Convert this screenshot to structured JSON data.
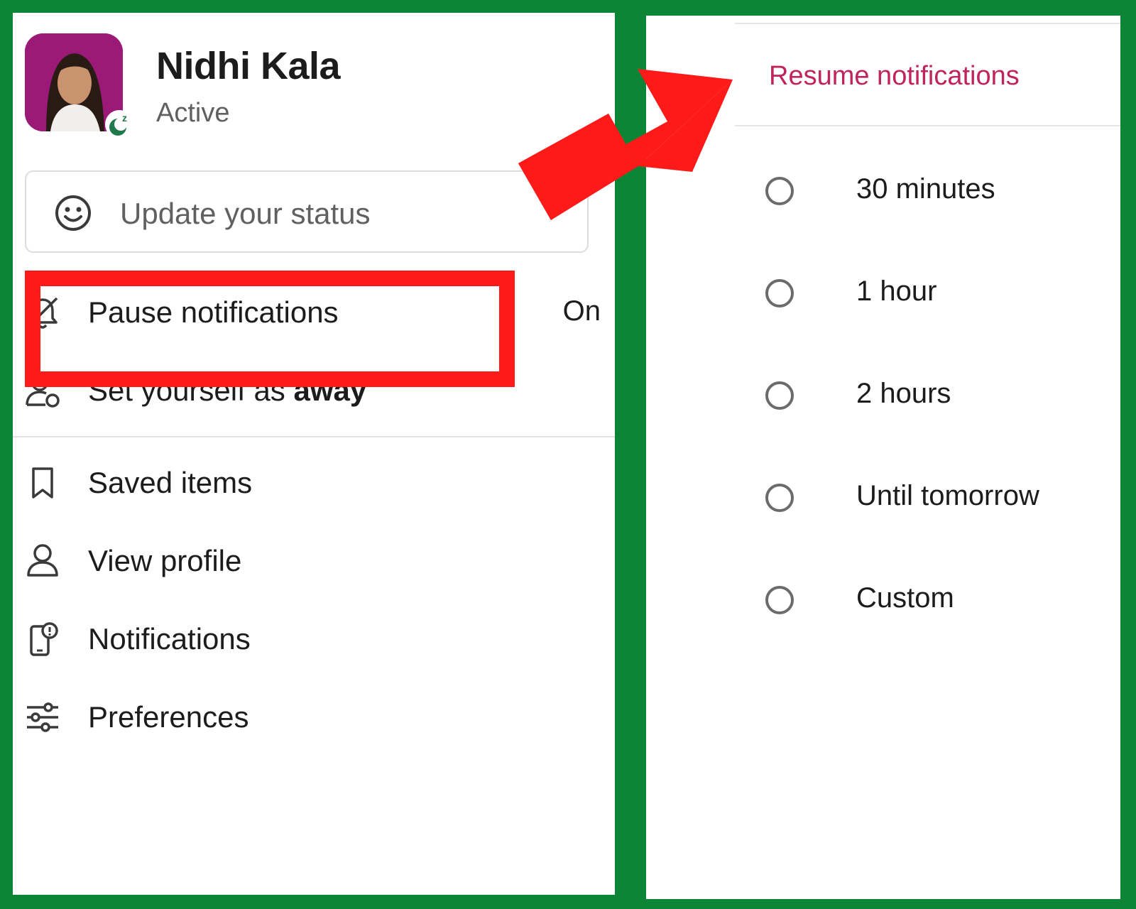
{
  "profile": {
    "name": "Nidhi Kala",
    "presence": "Active",
    "badge_icon": "snooze-icon"
  },
  "status": {
    "placeholder": "Update your status",
    "icon": "smiley-icon"
  },
  "menu": {
    "pause": {
      "label": "Pause notifications",
      "value": "On",
      "icon": "bell-off-icon"
    },
    "away": {
      "label_prefix": "Set yourself as ",
      "label_bold": "away",
      "icon": "user-away-icon"
    },
    "saved": {
      "label": "Saved items",
      "icon": "bookmark-icon"
    },
    "profile": {
      "label": "View profile",
      "icon": "user-icon"
    },
    "notifications": {
      "label": "Notifications",
      "icon": "phone-alert-icon"
    },
    "preferences": {
      "label": "Preferences",
      "icon": "sliders-icon"
    }
  },
  "pause_menu": {
    "resume_label": "Resume notifications",
    "options": [
      "30 minutes",
      "1 hour",
      "2 hours",
      "Until tomorrow",
      "Custom"
    ]
  },
  "colors": {
    "frame": "#0b8535",
    "highlight": "#ff1a1a",
    "resume": "#c0245c"
  }
}
